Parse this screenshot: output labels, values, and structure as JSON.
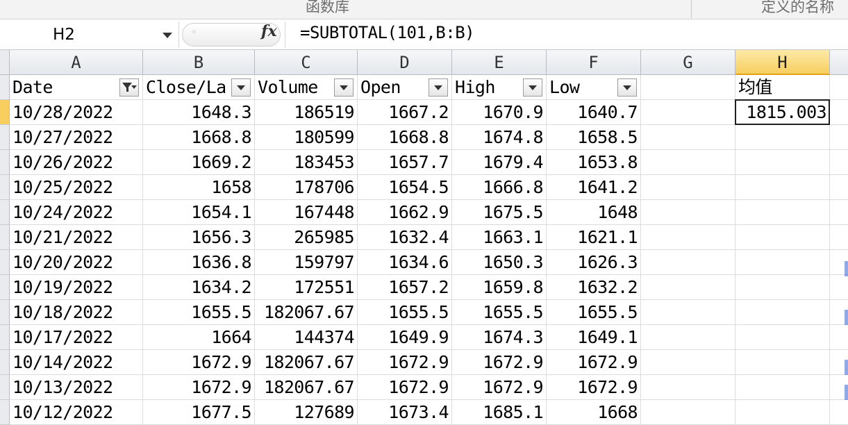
{
  "ribbon": {
    "group_left": "函数库",
    "group_right": "定义的名称"
  },
  "formula_bar": {
    "name_box": "H2",
    "formula": "=SUBTOTAL(101,B:B)",
    "fx_label": "fx"
  },
  "columns": [
    "A",
    "B",
    "C",
    "D",
    "E",
    "F",
    "G",
    "H"
  ],
  "selected_column": "H",
  "headers": {
    "A": "Date",
    "B": "Close/La",
    "C": "Volume",
    "D": "Open",
    "E": "High",
    "F": "Low",
    "H": "均值"
  },
  "filter_active_column": "A",
  "rows": [
    {
      "date": "10/28/2022",
      "close": "1648.3",
      "volume": "186519",
      "open": "1667.2",
      "high": "1670.9",
      "low": "1640.7"
    },
    {
      "date": "10/27/2022",
      "close": "1668.8",
      "volume": "180599",
      "open": "1668.8",
      "high": "1674.8",
      "low": "1658.5"
    },
    {
      "date": "10/26/2022",
      "close": "1669.2",
      "volume": "183453",
      "open": "1657.7",
      "high": "1679.4",
      "low": "1653.8"
    },
    {
      "date": "10/25/2022",
      "close": "1658",
      "volume": "178706",
      "open": "1654.5",
      "high": "1666.8",
      "low": "1641.2"
    },
    {
      "date": "10/24/2022",
      "close": "1654.1",
      "volume": "167448",
      "open": "1662.9",
      "high": "1675.5",
      "low": "1648"
    },
    {
      "date": "10/21/2022",
      "close": "1656.3",
      "volume": "265985",
      "open": "1632.4",
      "high": "1663.1",
      "low": "1621.1"
    },
    {
      "date": "10/20/2022",
      "close": "1636.8",
      "volume": "159797",
      "open": "1634.6",
      "high": "1650.3",
      "low": "1626.3"
    },
    {
      "date": "10/19/2022",
      "close": "1634.2",
      "volume": "172551",
      "open": "1657.2",
      "high": "1659.8",
      "low": "1632.2"
    },
    {
      "date": "10/18/2022",
      "close": "1655.5",
      "volume": "182067.67",
      "open": "1655.5",
      "high": "1655.5",
      "low": "1655.5"
    },
    {
      "date": "10/17/2022",
      "close": "1664",
      "volume": "144374",
      "open": "1649.9",
      "high": "1674.3",
      "low": "1649.1"
    },
    {
      "date": "10/14/2022",
      "close": "1672.9",
      "volume": "182067.67",
      "open": "1672.9",
      "high": "1672.9",
      "low": "1672.9"
    },
    {
      "date": "10/13/2022",
      "close": "1672.9",
      "volume": "182067.67",
      "open": "1672.9",
      "high": "1672.9",
      "low": "1672.9"
    },
    {
      "date": "10/12/2022",
      "close": "1677.5",
      "volume": "127689",
      "open": "1673.4",
      "high": "1685.1",
      "low": "1668"
    }
  ],
  "h_value": "1815.003",
  "active_cell": "H2",
  "colors": {
    "selected_header": "#f8cf5f",
    "gridline": "#dadcdd",
    "header_bg": "#e4e7eb"
  }
}
